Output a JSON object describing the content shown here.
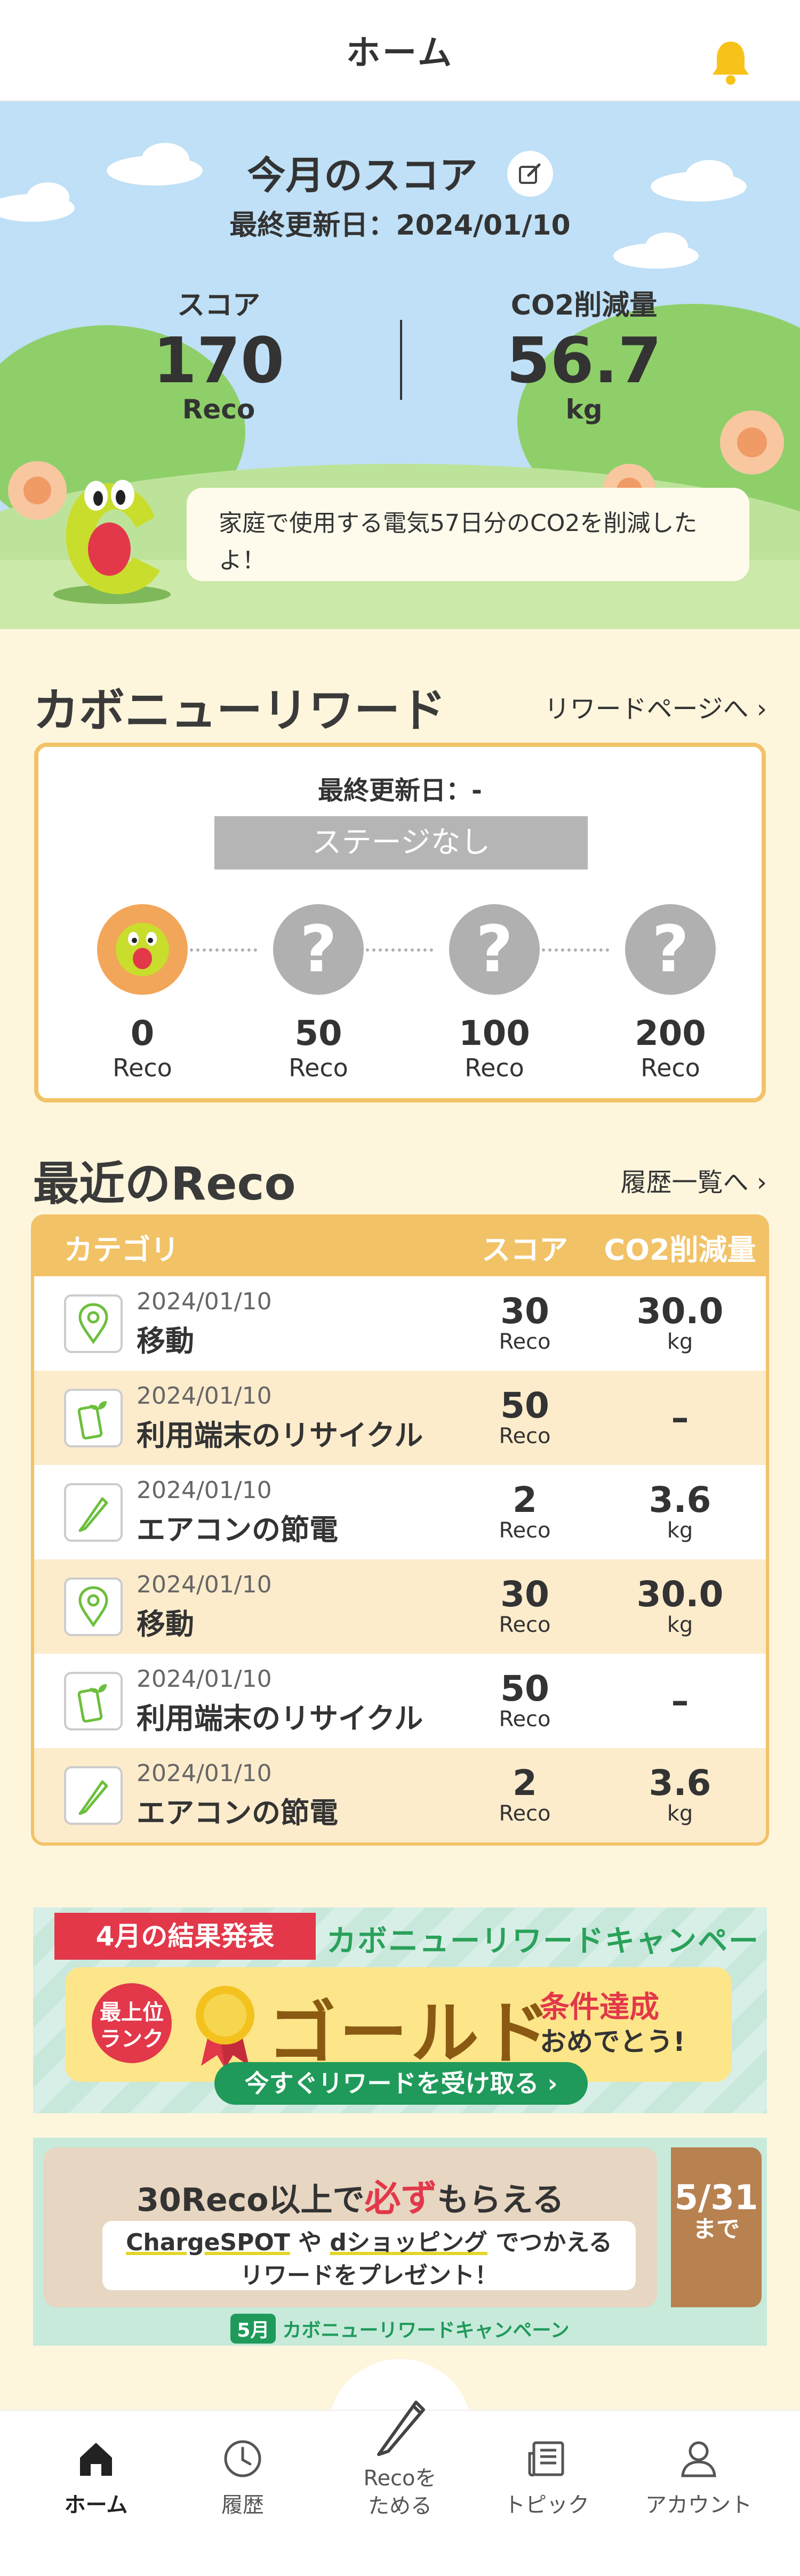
{
  "header": {
    "title": "ホーム",
    "bell_icon": "bell-icon"
  },
  "hero": {
    "title": "今月のスコア",
    "updated": "最終更新日：2024/01/10",
    "score": {
      "label": "スコア",
      "value": "170",
      "unit": "Reco"
    },
    "co2": {
      "label": "CO2削減量",
      "value": "56.7",
      "unit": "kg"
    },
    "message": "家庭で使用する電気57日分のCO2を削減したよ！"
  },
  "reward": {
    "heading": "カボニューリワード",
    "link": "リワードページへ ›",
    "updated": "最終更新日：-",
    "stage": "ステージなし",
    "stages": [
      {
        "value": "0",
        "unit": "Reco",
        "mark": ""
      },
      {
        "value": "50",
        "unit": "Reco",
        "mark": "?"
      },
      {
        "value": "100",
        "unit": "Reco",
        "mark": "?"
      },
      {
        "value": "200",
        "unit": "Reco",
        "mark": "?"
      }
    ]
  },
  "recent": {
    "heading": "最近のReco",
    "link": "履歴一覧へ ›",
    "columns": {
      "category": "カテゴリ",
      "score": "スコア",
      "co2": "CO2削減量"
    },
    "rows": [
      {
        "date": "2024/01/10",
        "name": "移動",
        "score": "30",
        "score_unit": "Reco",
        "co2": "30.0",
        "co2_unit": "kg",
        "icon": "location-pin-icon"
      },
      {
        "date": "2024/01/10",
        "name": "利用端末のリサイクル",
        "score": "50",
        "score_unit": "Reco",
        "co2": "–",
        "co2_unit": "",
        "icon": "phone-sprout-icon"
      },
      {
        "date": "2024/01/10",
        "name": "エアコンの節電",
        "score": "2",
        "score_unit": "Reco",
        "co2": "3.6",
        "co2_unit": "kg",
        "icon": "pencil-icon"
      },
      {
        "date": "2024/01/10",
        "name": "移動",
        "score": "30",
        "score_unit": "Reco",
        "co2": "30.0",
        "co2_unit": "kg",
        "icon": "location-pin-icon"
      },
      {
        "date": "2024/01/10",
        "name": "利用端末のリサイクル",
        "score": "50",
        "score_unit": "Reco",
        "co2": "–",
        "co2_unit": "",
        "icon": "phone-sprout-icon"
      },
      {
        "date": "2024/01/10",
        "name": "エアコンの節電",
        "score": "2",
        "score_unit": "Reco",
        "co2": "3.6",
        "co2_unit": "kg",
        "icon": "pencil-icon"
      }
    ]
  },
  "banner1": {
    "ribbon": "4月の結果発表",
    "title": "カボニューリワードキャンペーン",
    "rank": "最上位ランク",
    "rank_line1": "最上位",
    "rank_line2": "ランク",
    "gold": "ゴールド",
    "condition": "条件達成",
    "congrats": "おめでとう!",
    "cta": "今すぐリワードを受け取る ›"
  },
  "banner2": {
    "title_pre": "30Reco以上で",
    "title_hl": "必ず",
    "title_post": "もらえる",
    "line1_a": "ChargeSPOT",
    "line1_b": " や ",
    "line1_c": "dショッピング",
    "line1_d": " でつかえる",
    "line2": "リワードをプレゼント！",
    "date": "5/31",
    "until": "まで",
    "footer_tag": "5月",
    "footer": "カボニューリワードキャンペーン"
  },
  "nav": {
    "home": "ホーム",
    "history": "履歴",
    "collect_line1": "Recoを",
    "collect_line2": "ためる",
    "topic": "トピック",
    "account": "アカウント"
  },
  "colors": {
    "accent": "#f2c267",
    "background": "#fdf6dd",
    "sky": "#bfe0f6",
    "grass": "#9fd27c"
  }
}
